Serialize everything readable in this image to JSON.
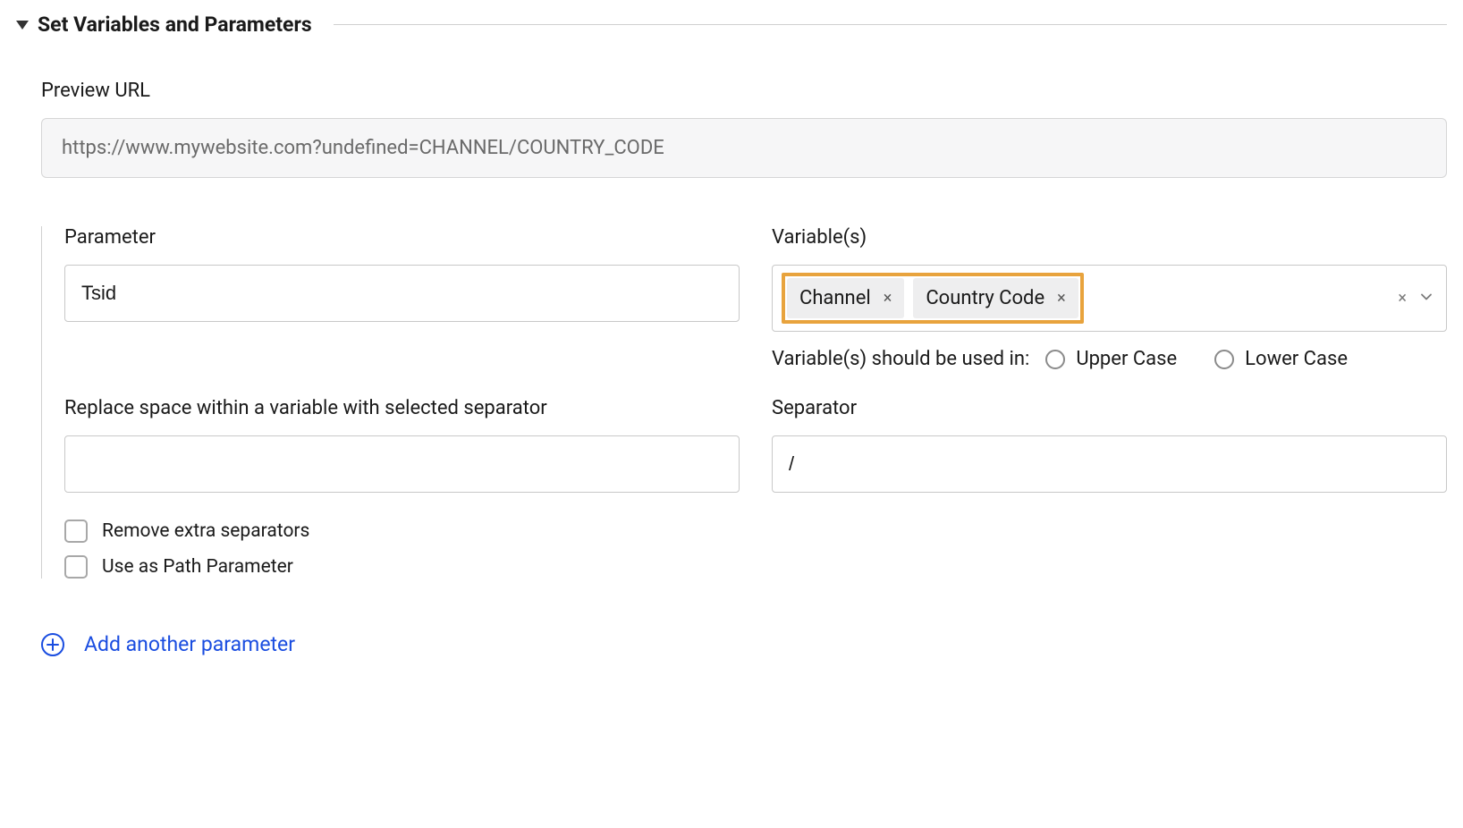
{
  "section": {
    "title": "Set Variables and Parameters"
  },
  "preview_url": {
    "label": "Preview URL",
    "value": "https://www.mywebsite.com?undefined=CHANNEL/COUNTRY_CODE"
  },
  "parameter": {
    "label": "Parameter",
    "value": "Tsid"
  },
  "variables": {
    "label": "Variable(s)",
    "tags": [
      {
        "label": "Channel"
      },
      {
        "label": "Country Code"
      }
    ],
    "case_label": "Variable(s) should be used in:",
    "upper_case_label": "Upper Case",
    "lower_case_label": "Lower Case"
  },
  "replace_space": {
    "label": "Replace space within a variable with selected separator",
    "value": ""
  },
  "separator": {
    "label": "Separator",
    "value": "/"
  },
  "checkboxes": {
    "remove_extra": "Remove extra separators",
    "use_as_path": "Use as Path Parameter"
  },
  "add_parameter": {
    "label": "Add another parameter"
  }
}
